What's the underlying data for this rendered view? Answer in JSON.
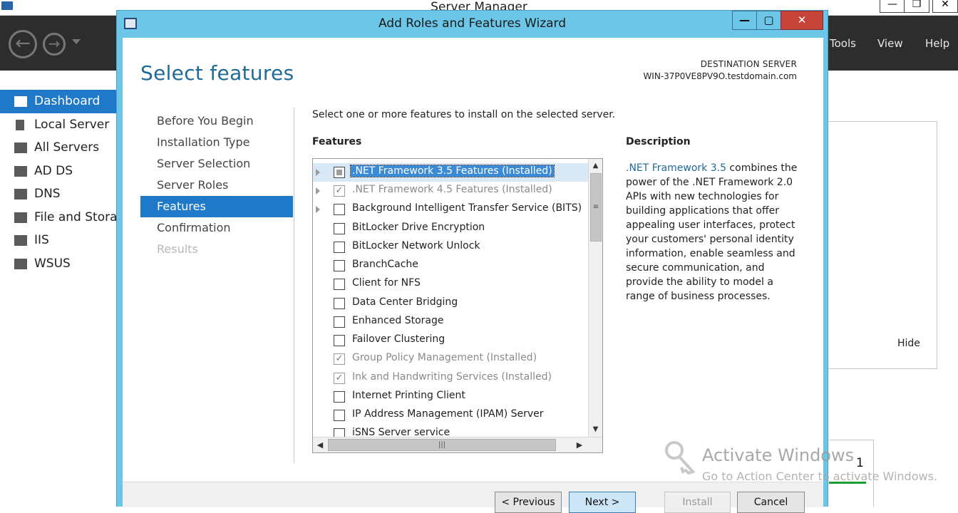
{
  "server_manager": {
    "title": "Server Manager",
    "menu": [
      "Tools",
      "View",
      "Help"
    ],
    "sidebar": [
      {
        "label": "Dashboard",
        "selected": true
      },
      {
        "label": "Local Server"
      },
      {
        "label": "All Servers"
      },
      {
        "label": "AD DS"
      },
      {
        "label": "DNS"
      },
      {
        "label": "File and Storag"
      },
      {
        "label": "IIS"
      },
      {
        "label": "WSUS"
      }
    ],
    "panel_hide_label": "Hide",
    "card_count": "1"
  },
  "wizard": {
    "title": "Add Roles and Features Wizard",
    "page_title": "Select features",
    "destination_label": "DESTINATION SERVER",
    "destination_value": "WIN-37P0VE8PV9O.testdomain.com",
    "steps": [
      {
        "label": "Before You Begin"
      },
      {
        "label": "Installation Type"
      },
      {
        "label": "Server Selection"
      },
      {
        "label": "Server Roles"
      },
      {
        "label": "Features",
        "selected": true
      },
      {
        "label": "Confirmation"
      },
      {
        "label": "Results",
        "disabled": true
      }
    ],
    "instruction": "Select one or more features to install on the selected server.",
    "features_heading": "Features",
    "features": [
      {
        "label": ".NET Framework 3.5 Features (Installed)",
        "expandable": true,
        "state": "partial",
        "selected": true
      },
      {
        "label": ".NET Framework 4.5 Features (Installed)",
        "expandable": true,
        "state": "checked",
        "disabled": true
      },
      {
        "label": "Background Intelligent Transfer Service (BITS)",
        "expandable": true,
        "state": "unchecked"
      },
      {
        "label": "BitLocker Drive Encryption",
        "state": "unchecked"
      },
      {
        "label": "BitLocker Network Unlock",
        "state": "unchecked"
      },
      {
        "label": "BranchCache",
        "state": "unchecked"
      },
      {
        "label": "Client for NFS",
        "state": "unchecked"
      },
      {
        "label": "Data Center Bridging",
        "state": "unchecked"
      },
      {
        "label": "Enhanced Storage",
        "state": "unchecked"
      },
      {
        "label": "Failover Clustering",
        "state": "unchecked"
      },
      {
        "label": "Group Policy Management (Installed)",
        "state": "checked",
        "disabled": true
      },
      {
        "label": "Ink and Handwriting Services (Installed)",
        "state": "checked",
        "disabled": true
      },
      {
        "label": "Internet Printing Client",
        "state": "unchecked"
      },
      {
        "label": "IP Address Management (IPAM) Server",
        "state": "unchecked"
      },
      {
        "label": "iSNS Server service",
        "state": "unchecked"
      }
    ],
    "description_heading": "Description",
    "description_link": ".NET Framework 3.5",
    "description_text": " combines the power of the .NET Framework 2.0 APIs with new technologies for building applications that offer appealing user interfaces, protect your customers' personal identity information, enable seamless and secure communication, and provide the ability to model a range of business processes.",
    "buttons": {
      "previous": "< Previous",
      "next": "Next >",
      "install": "Install",
      "cancel": "Cancel"
    }
  },
  "watermark": {
    "title": "Activate Windows",
    "subtitle": "Go to Action Center to activate Windows."
  },
  "colors": {
    "accent": "#1f78c8",
    "title_bar": "#6cc6e8",
    "page_title": "#1f6b97",
    "close_button": "#c7443b"
  }
}
